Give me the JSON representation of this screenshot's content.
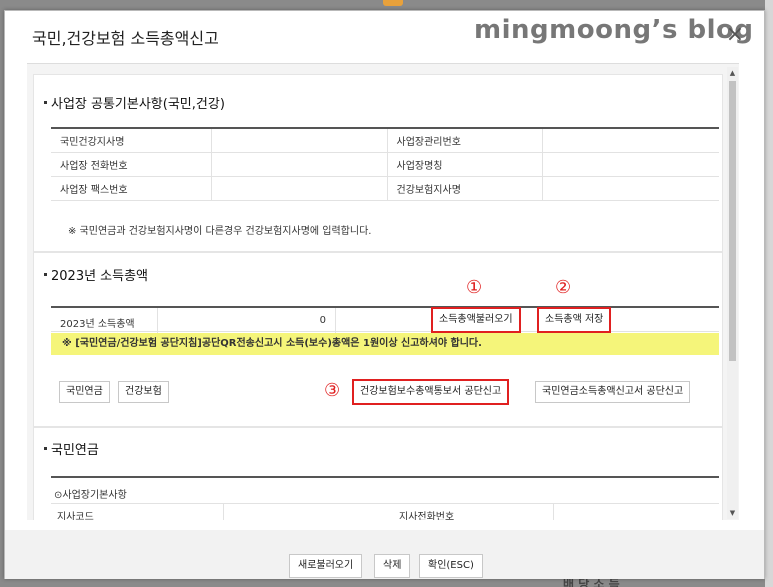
{
  "dialog": {
    "title": "국민,건강보험 소득총액신고",
    "watermark": "mingmoong’s blog",
    "close": "×"
  },
  "section1": {
    "heading": "사업장 공통기본사항(국민,건강)",
    "rows": [
      {
        "label": "국민건강지사명",
        "value": "",
        "label2": "사업장관리번호",
        "value2": ""
      },
      {
        "label": "사업장 전화번호",
        "value": "",
        "label2": "사업장명칭",
        "value2": ""
      },
      {
        "label": "사업장 팩스번호",
        "value": "",
        "label2": "건강보험지사명",
        "value2": ""
      }
    ],
    "note": "※ 국민연금과 건강보험지사명이 다른경우 건강보험지사명에 입력합니다."
  },
  "section2": {
    "heading": "2023년 소득총액",
    "income_label": "2023년 소득총액",
    "income_value": "0",
    "load_button": "소득총액불러오기",
    "save_button": "소득총액 저장",
    "marker1": "①",
    "marker2": "②",
    "marker3": "③",
    "notice": "※ [국민연금/건강보험 공단지침]공단QR전송신고시 소득(보수)총액은 1원이상 신고하셔야 합니다.",
    "tab_pension": "국민연금",
    "tab_health": "건강보험",
    "health_submit_button": "건강보험보수총액통보서 공단신고",
    "pension_submit_button": "국민연금소득총액신고서 공단신고"
  },
  "section3": {
    "heading": "국민연금",
    "sub_heading": "⊙사업장기본사항",
    "row_label": "지사코드",
    "row_label2": "지사전화번호"
  },
  "footer": {
    "reload": "새로불러오기",
    "delete": "삭제",
    "confirm": "확인(ESC)"
  },
  "background": {
    "bottom_text": "배 당 소 득"
  },
  "colors": {
    "highlight": "#e02020",
    "notice_bg": "#f5f57a"
  }
}
